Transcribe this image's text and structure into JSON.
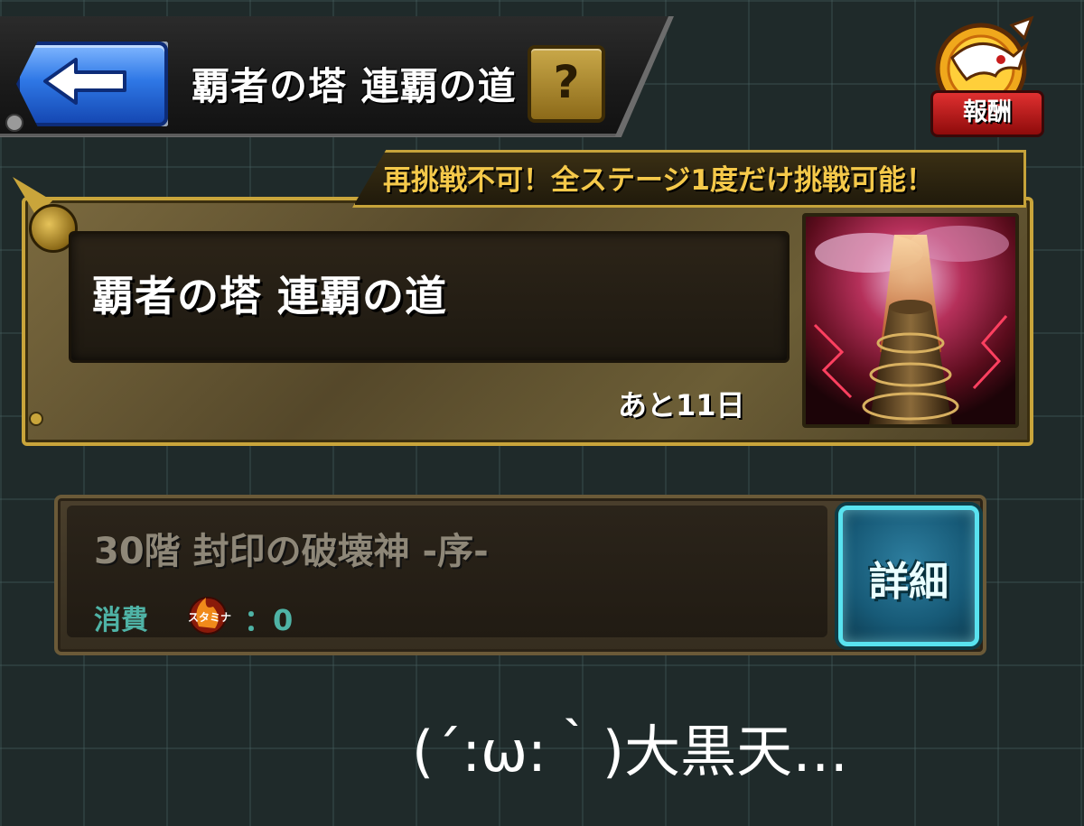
{
  "header": {
    "title": "覇者の塔 連覇の道",
    "help_label": "?"
  },
  "reward": {
    "label": "報酬"
  },
  "event": {
    "banner": "再挑戦不可！全ステージ1度だけ挑戦可能！",
    "title": "覇者の塔 連覇の道",
    "remaining": "あと11日"
  },
  "stage": {
    "title": "30階 封印の破壊神 -序-",
    "cost_label": "消費",
    "stamina_icon_text": "スタミナ",
    "cost_value": "：0",
    "detail_label": "詳細"
  },
  "caption": "(´:ω:｀)大黒天…",
  "colors": {
    "accent_gold": "#c9a53b",
    "back_button_blue": "#2f78e6",
    "detail_button_cyan": "#59e3f0",
    "banner_text": "#f5c94a",
    "cost_teal": "#4fb3a6"
  },
  "icons": {
    "back": "left-arrow-icon",
    "help": "question-icon",
    "reward": "dragon-emblem-icon",
    "stamina": "stamina-flame-icon"
  }
}
